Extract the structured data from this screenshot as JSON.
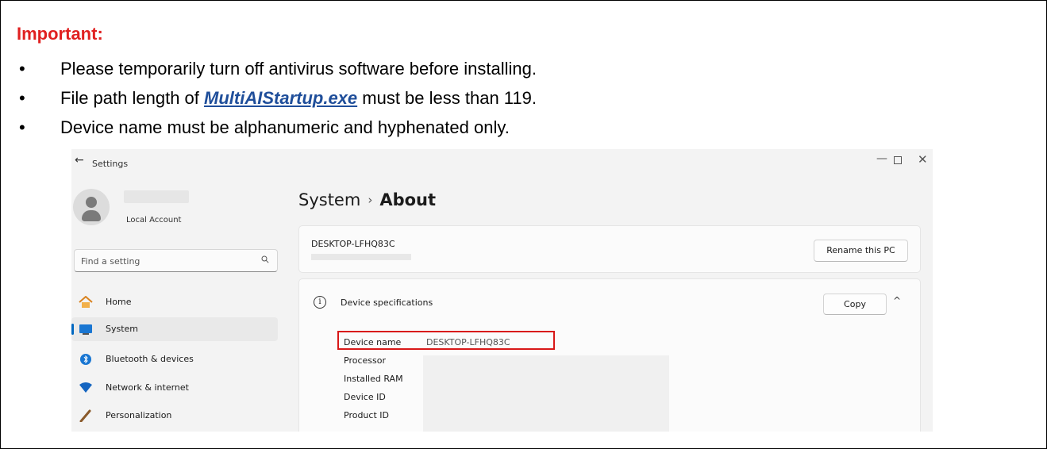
{
  "instructions": {
    "heading": "Important:",
    "bullet_char": "•",
    "items": [
      {
        "text": "Please temporarily turn off antivirus software before installing."
      },
      {
        "text_before": "File path length of ",
        "filename": "MultiAIStartup.exe",
        "text_after": " must be less than 119."
      },
      {
        "text": "Device name must be alphanumeric and hyphenated only."
      }
    ]
  },
  "settings_window": {
    "title": "Settings",
    "controls": {
      "back": "←",
      "minimize": "—",
      "close": "✕"
    },
    "account": {
      "label": "Local Account"
    },
    "search": {
      "placeholder": "Find a setting"
    },
    "nav": [
      {
        "label": "Home",
        "icon": "home-icon"
      },
      {
        "label": "System",
        "icon": "system-icon",
        "active": true
      },
      {
        "label": "Bluetooth & devices",
        "icon": "bluetooth-icon"
      },
      {
        "label": "Network & internet",
        "icon": "wifi-icon"
      },
      {
        "label": "Personalization",
        "icon": "brush-icon"
      }
    ],
    "breadcrumb": {
      "parent": "System",
      "separator": "›",
      "current": "About"
    },
    "pc_card": {
      "pc_name": "DESKTOP-LFHQ83C",
      "rename_button": "Rename this PC"
    },
    "specs": {
      "title": "Device specifications",
      "copy_button": "Copy",
      "rows": [
        {
          "label": "Device name",
          "value": "DESKTOP-LFHQ83C"
        },
        {
          "label": "Processor",
          "value": ""
        },
        {
          "label": "Installed RAM",
          "value": ""
        },
        {
          "label": "Device ID",
          "value": ""
        },
        {
          "label": "Product ID",
          "value": ""
        }
      ]
    },
    "accent_color": "#0067c0",
    "highlight_color": "#d81818"
  }
}
